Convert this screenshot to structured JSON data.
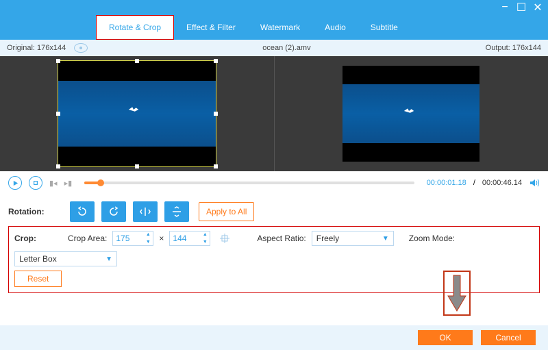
{
  "window": {
    "minimize": "−",
    "maximize": "☐",
    "close": "✕"
  },
  "tabs": {
    "rotate_crop": "Rotate & Crop",
    "effect_filter": "Effect & Filter",
    "watermark": "Watermark",
    "audio": "Audio",
    "subtitle": "Subtitle"
  },
  "info": {
    "original_label": "Original: 176x144",
    "filename": "ocean (2).amv",
    "output_label": "Output: 176x144"
  },
  "player": {
    "current": "00:00:01.18",
    "sep": "/",
    "total": "00:00:46.14"
  },
  "rotation": {
    "label": "Rotation:",
    "apply_all": "Apply to All"
  },
  "crop": {
    "label": "Crop:",
    "area_label": "Crop Area:",
    "w": "175",
    "h": "144",
    "aspect_label": "Aspect Ratio:",
    "aspect_value": "Freely",
    "zoom_label": "Zoom Mode:",
    "zoom_value": "Letter Box",
    "reset": "Reset",
    "multiply": "×"
  },
  "footer": {
    "ok": "OK",
    "cancel": "Cancel"
  }
}
